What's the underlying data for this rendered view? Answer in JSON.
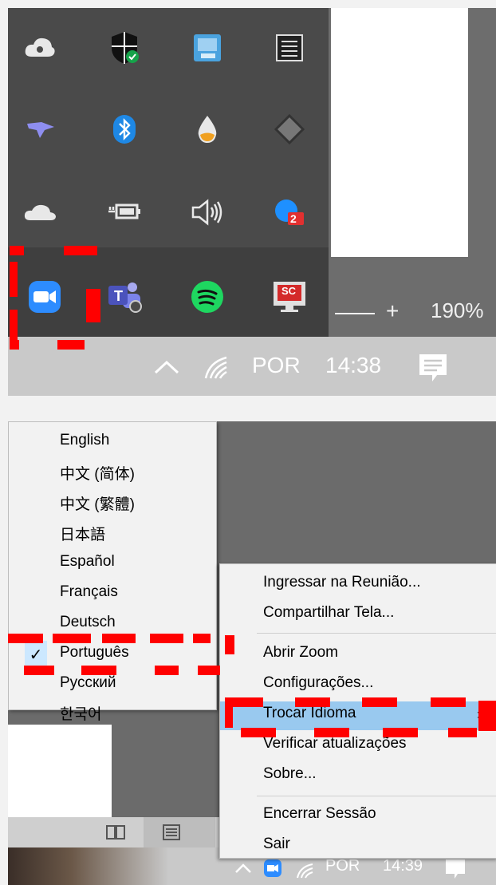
{
  "top_panel": {
    "tray_icons": [
      {
        "name": "creative-cloud-icon"
      },
      {
        "name": "windows-security-icon"
      },
      {
        "name": "app-icon-blue"
      },
      {
        "name": "app-icon-grid"
      },
      {
        "name": "bird-app-icon"
      },
      {
        "name": "bluetooth-icon"
      },
      {
        "name": "droplet-icon"
      },
      {
        "name": "diamond-icon"
      },
      {
        "name": "onedrive-icon"
      },
      {
        "name": "power-icon"
      },
      {
        "name": "volume-icon"
      },
      {
        "name": "app-badge-icon",
        "badge": "2"
      },
      {
        "name": "zoom-icon"
      },
      {
        "name": "teams-icon"
      },
      {
        "name": "spotify-icon"
      },
      {
        "name": "screencast-icon",
        "label": "SC"
      }
    ],
    "zoom_plus": "+",
    "zoom_level": "190%",
    "taskbar": {
      "language": "POR",
      "time": "14:38"
    }
  },
  "bottom_panel": {
    "language_menu": {
      "items": [
        "English",
        "中文 (简体)",
        "中文 (繁體)",
        "日本語",
        "Español",
        "Français",
        "Deutsch",
        "Português",
        "Русский",
        "한국어"
      ],
      "checked_index": 7,
      "check_mark": "✓"
    },
    "context_menu": {
      "items": [
        "Ingressar na Reunião...",
        "Compartilhar Tela...",
        "Abrir Zoom",
        "Configurações...",
        "Trocar Idioma",
        "Verificar atualizações",
        "Sobre...",
        "Encerrar Sessão",
        "Sair"
      ],
      "highlighted": "Trocar Idioma",
      "submenu_arrow": "›"
    },
    "taskbar": {
      "language": "POR",
      "time": "14:39"
    }
  },
  "colors": {
    "highlight_red": "#ff0000",
    "menu_highlight": "#99c9ef",
    "check_bg": "#cce8ff",
    "spotify_green": "#1ed760",
    "zoom_blue": "#2d8cff"
  }
}
